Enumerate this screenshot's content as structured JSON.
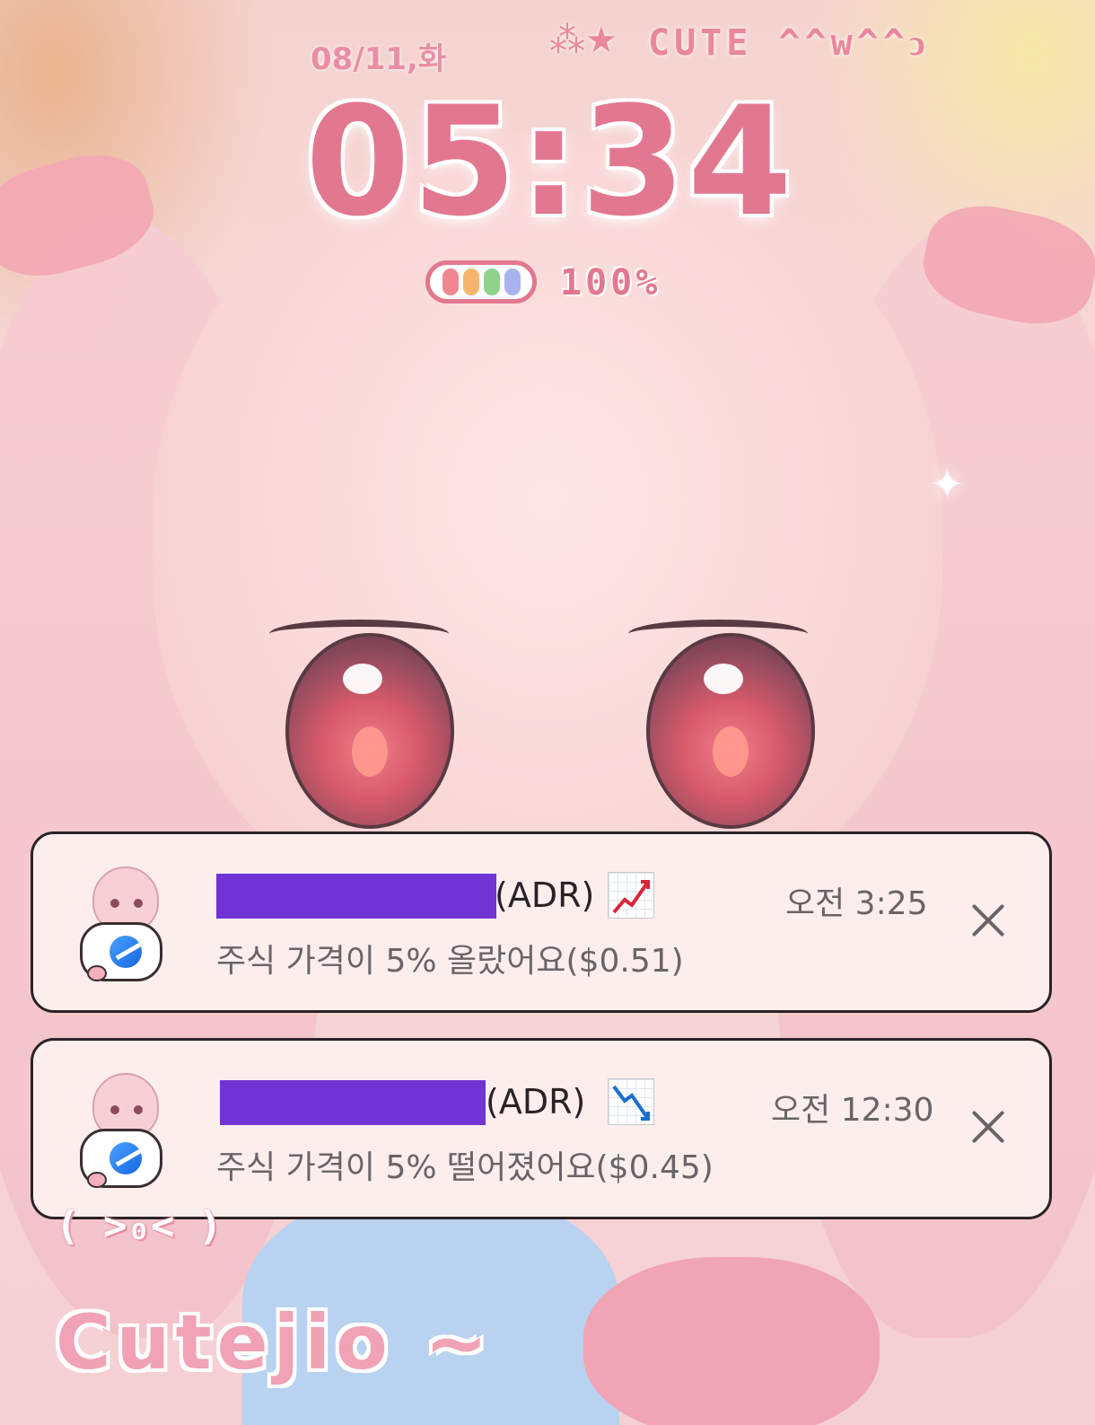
{
  "lockscreen": {
    "date": "08/11,화",
    "stars": "⁂★",
    "tagline": "CUTE ^^w^^ↄ",
    "time": "05:34",
    "battery": {
      "level": 1.0,
      "label": "100%",
      "cell_colors": [
        "#f0868f",
        "#f6b56a",
        "#8ed38a",
        "#a9b4ef"
      ]
    },
    "sparkle": "✦"
  },
  "notifications": [
    {
      "title_suffix": "(ADR)",
      "trend_icon": "chart-increasing-icon",
      "time": "오전 3:25",
      "body": "주식 가격이 5% 올랐어요($0.51)"
    },
    {
      "title_suffix": "(ADR)",
      "trend_icon": "chart-decreasing-icon",
      "time": "오전 12:30",
      "body": "주식 가격이 5% 떨어졌어요($0.45)"
    }
  ],
  "wallpaper": {
    "kaomoji": "( >₀< )",
    "signature": "Cutejio ~"
  },
  "colors": {
    "accent_pink": "#e27890",
    "redaction": "#7133d4",
    "notification_bg": "#fdeeee"
  }
}
